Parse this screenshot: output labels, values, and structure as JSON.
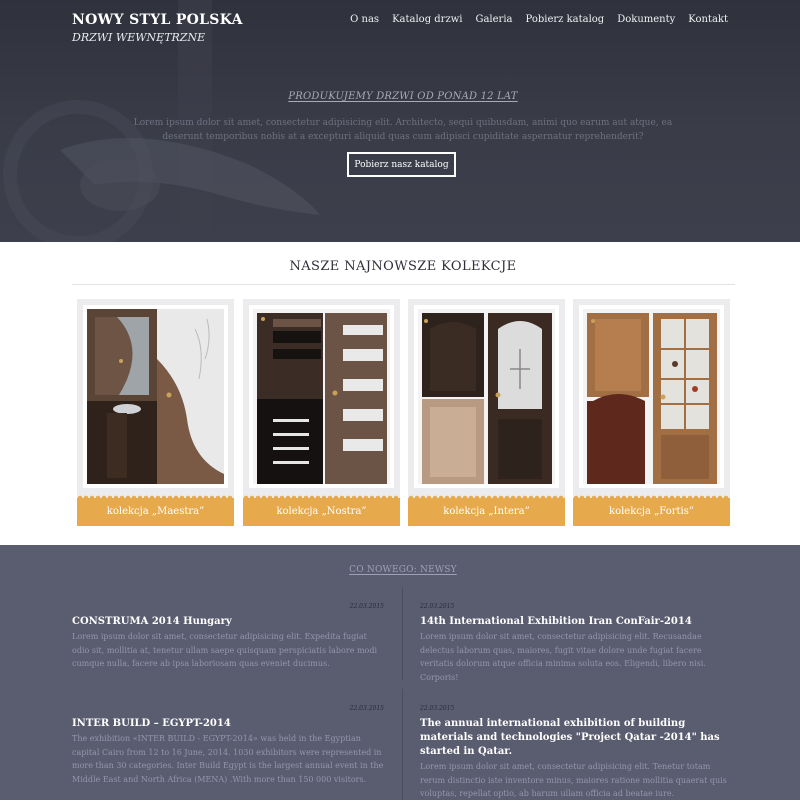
{
  "brand": {
    "name": "NOWY STYL POLSKA",
    "tagline": "DRZWI WEWNĘTRZNE"
  },
  "nav": [
    "O nas",
    "Katalog drzwi",
    "Galeria",
    "Pobierz katalog",
    "Dokumenty",
    "Kontakt"
  ],
  "hero": {
    "title": "PRODUKUJEMY DRZWI OD PONAD 12 LAT",
    "text": "Lorem ipsum dolor sit amet, consectetur adipisicing elit. Architecto, sequi quibusdam, animi quo earum aut atque, ea deserunt temporibus nobis at a excepturi aliquid quas cum adipisci cupiditate aspernatur reprehenderit?",
    "cta": "Pobierz nasz katalog"
  },
  "collections": {
    "title": "NASZE NAJNOWSZE KOLEKCJE",
    "items": [
      {
        "label": "kolekcja „Maestra”"
      },
      {
        "label": "kolekcja „Nostra”"
      },
      {
        "label": "kolekcja „Intera”"
      },
      {
        "label": "kolekcja „Fortis”"
      }
    ]
  },
  "news": {
    "heading": "CO NOWEGO: NEWSY",
    "items": [
      {
        "date": "22.03.2015",
        "title": "CONSTRUMA 2014 Hungary",
        "body": "Lorem ipsum dolor sit amet, consectetur adipisicing elit. Expedita fugiat odio sit, mollitia at, tenetur ullam saepe quisquam perspiciatis labore modi cumque nulla, facere ab ipsa laboriosam quas eveniet ducimus."
      },
      {
        "date": "22.03.2015",
        "title": "14th International Exhibition Iran ConFair-2014",
        "body": "Lorem ipsum dolor sit amet, consectetur adipisicing elit. Recusandae delectus laborum quas, maiores, fugit vitae dolore unde fugiat facere veritatis dolorum atque officia minima soluta eos. Eligendi, libero nisi. Corporis!"
      },
      {
        "date": "22.03.2015",
        "title": "INTER BUILD – EGYPT-2014",
        "body": "The exhibition «INTER BUILD - EGYPT-2014» was held in the Egyptian capital Cairo from 12 to 16 June, 2014. 1030 exhibitors were represented in more than 30 categories. Inter Build Egypt is the largest annual event in the Middle East and North Africa (MENA) .With more than 150 000 visitors."
      },
      {
        "date": "22.03.2015",
        "title": "The annual international exhibition of building materials and technologies \"Project Qatar -2014\" has started in Qatar.",
        "body": "Lorem ipsum dolor sit amet, consectetur adipisicing elit. Tenetur totam rerum distinctio iste inventore minus, maiores ratione mollitia quaerat quis voluptas, repellat optio, ab harum ullam officia ad beatae iure."
      }
    ]
  }
}
